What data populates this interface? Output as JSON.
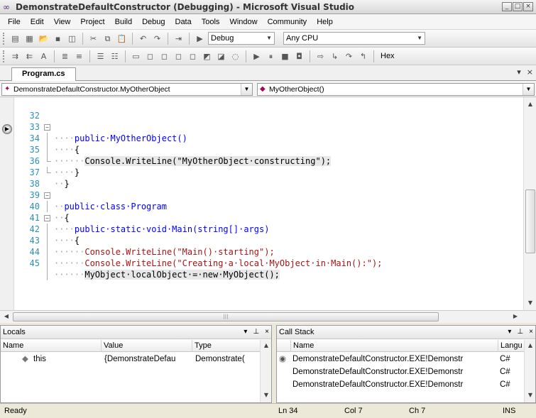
{
  "window": {
    "title": "DemonstrateDefaultConstructor (Debugging) - Microsoft Visual Studio"
  },
  "menu": [
    "File",
    "Edit",
    "View",
    "Project",
    "Build",
    "Debug",
    "Data",
    "Tools",
    "Window",
    "Community",
    "Help"
  ],
  "toolbar": {
    "config": "Debug",
    "platform": "Any CPU",
    "hex_label": "Hex"
  },
  "document_tab": "Program.cs",
  "nav": {
    "type_combo": "DemonstrateDefaultConstructor.MyOtherObject",
    "member_combo": "MyOtherObject()"
  },
  "code_lines": [
    {
      "num": "32",
      "ws": "····",
      "text": "public·MyOtherObject()"
    },
    {
      "num": "33",
      "ws": "····",
      "text": "{"
    },
    {
      "num": "34",
      "ws": "······",
      "text": "Console.WriteLine(\"MyOtherObject·constructing\");"
    },
    {
      "num": "35",
      "ws": "····",
      "text": "}"
    },
    {
      "num": "36",
      "ws": "··",
      "text": "}"
    },
    {
      "num": "37",
      "ws": "",
      "text": ""
    },
    {
      "num": "38",
      "ws": "··",
      "text": "public·class·Program"
    },
    {
      "num": "39",
      "ws": "··",
      "text": "{"
    },
    {
      "num": "40",
      "ws": "····",
      "text": "public·static·void·Main(string[]·args)"
    },
    {
      "num": "41",
      "ws": "····",
      "text": "{"
    },
    {
      "num": "42",
      "ws": "······",
      "text": "Console.WriteLine(\"Main()·starting\");"
    },
    {
      "num": "43",
      "ws": "······",
      "text": "Console.WriteLine(\"Creating·a·local·MyObject·in·Main():\");"
    },
    {
      "num": "44",
      "ws": "······",
      "text": "MyObject·localObject·=·new·MyObject();"
    },
    {
      "num": "45",
      "ws": "",
      "text": ""
    }
  ],
  "locals": {
    "title": "Locals",
    "columns": [
      "Name",
      "Value",
      "Type"
    ],
    "rows": [
      {
        "name": "this",
        "value": "{DemonstrateDefau",
        "type": "Demonstrate("
      }
    ]
  },
  "callstack": {
    "title": "Call Stack",
    "columns": [
      "Name",
      "Langu"
    ],
    "rows": [
      {
        "name": "DemonstrateDefaultConstructor.EXE!Demonstr",
        "lang": "C#"
      },
      {
        "name": "DemonstrateDefaultConstructor.EXE!Demonstr",
        "lang": "C#"
      },
      {
        "name": "DemonstrateDefaultConstructor.EXE!Demonstr",
        "lang": "C#"
      }
    ]
  },
  "status": {
    "ready": "Ready",
    "ln": "Ln 34",
    "col": "Col 7",
    "ch": "Ch 7",
    "mode": "INS"
  }
}
